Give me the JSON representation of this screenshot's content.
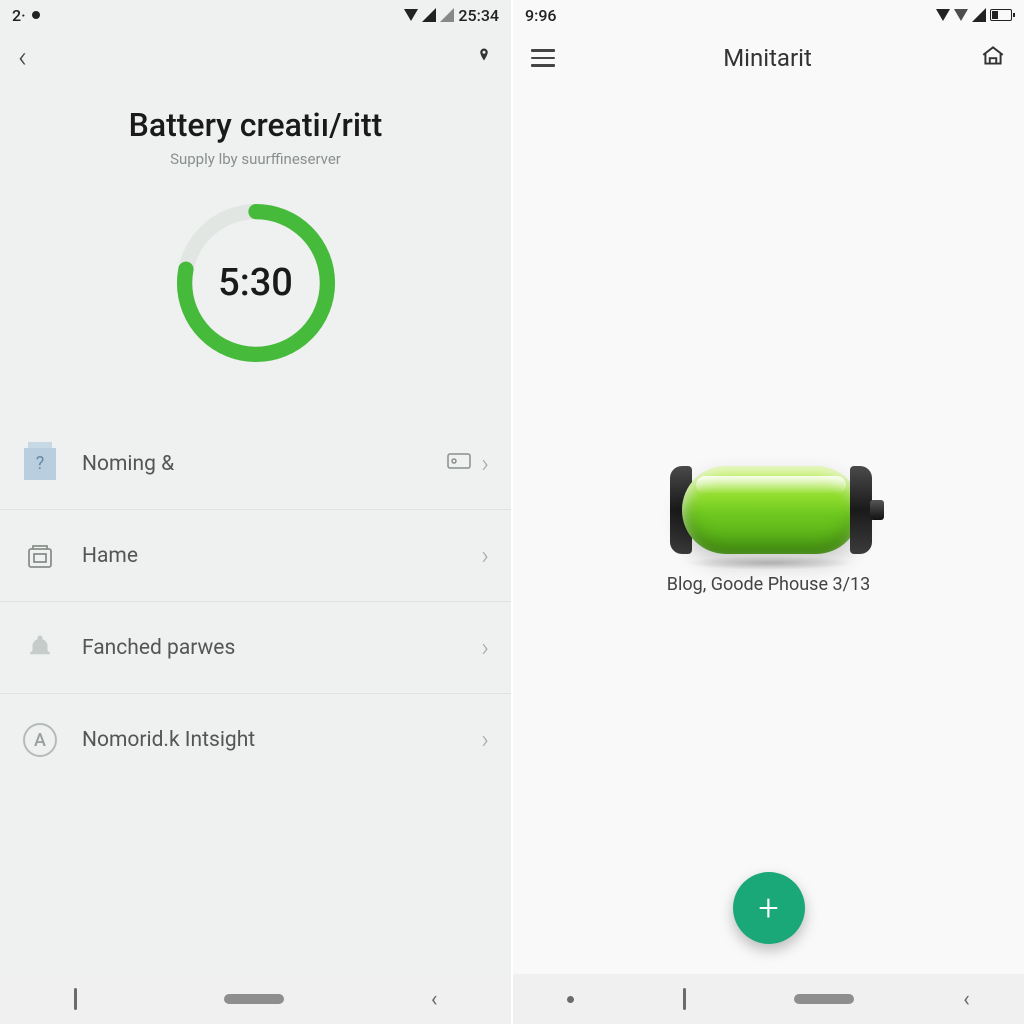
{
  "left": {
    "status": {
      "prefix": "2·",
      "time": "25:34"
    },
    "title": "Battery creatiı/ritt",
    "subtitle": "Supply lby suurffineserver",
    "ring_value": "5:30",
    "ring_percent": 78,
    "items": [
      {
        "label": "Noming &",
        "icon": "question-icon",
        "extra_icon": true
      },
      {
        "label": "Hame",
        "icon": "frame-icon"
      },
      {
        "label": "Fanched parwes",
        "icon": "bell-icon"
      },
      {
        "label": "Nomorid.k Intsight",
        "icon": "letter-a-icon"
      }
    ]
  },
  "right": {
    "status": {
      "time": "9:96"
    },
    "title": "Minitarit",
    "caption": "Blog, Goode Phouse 3/13",
    "fab_label": "+"
  }
}
